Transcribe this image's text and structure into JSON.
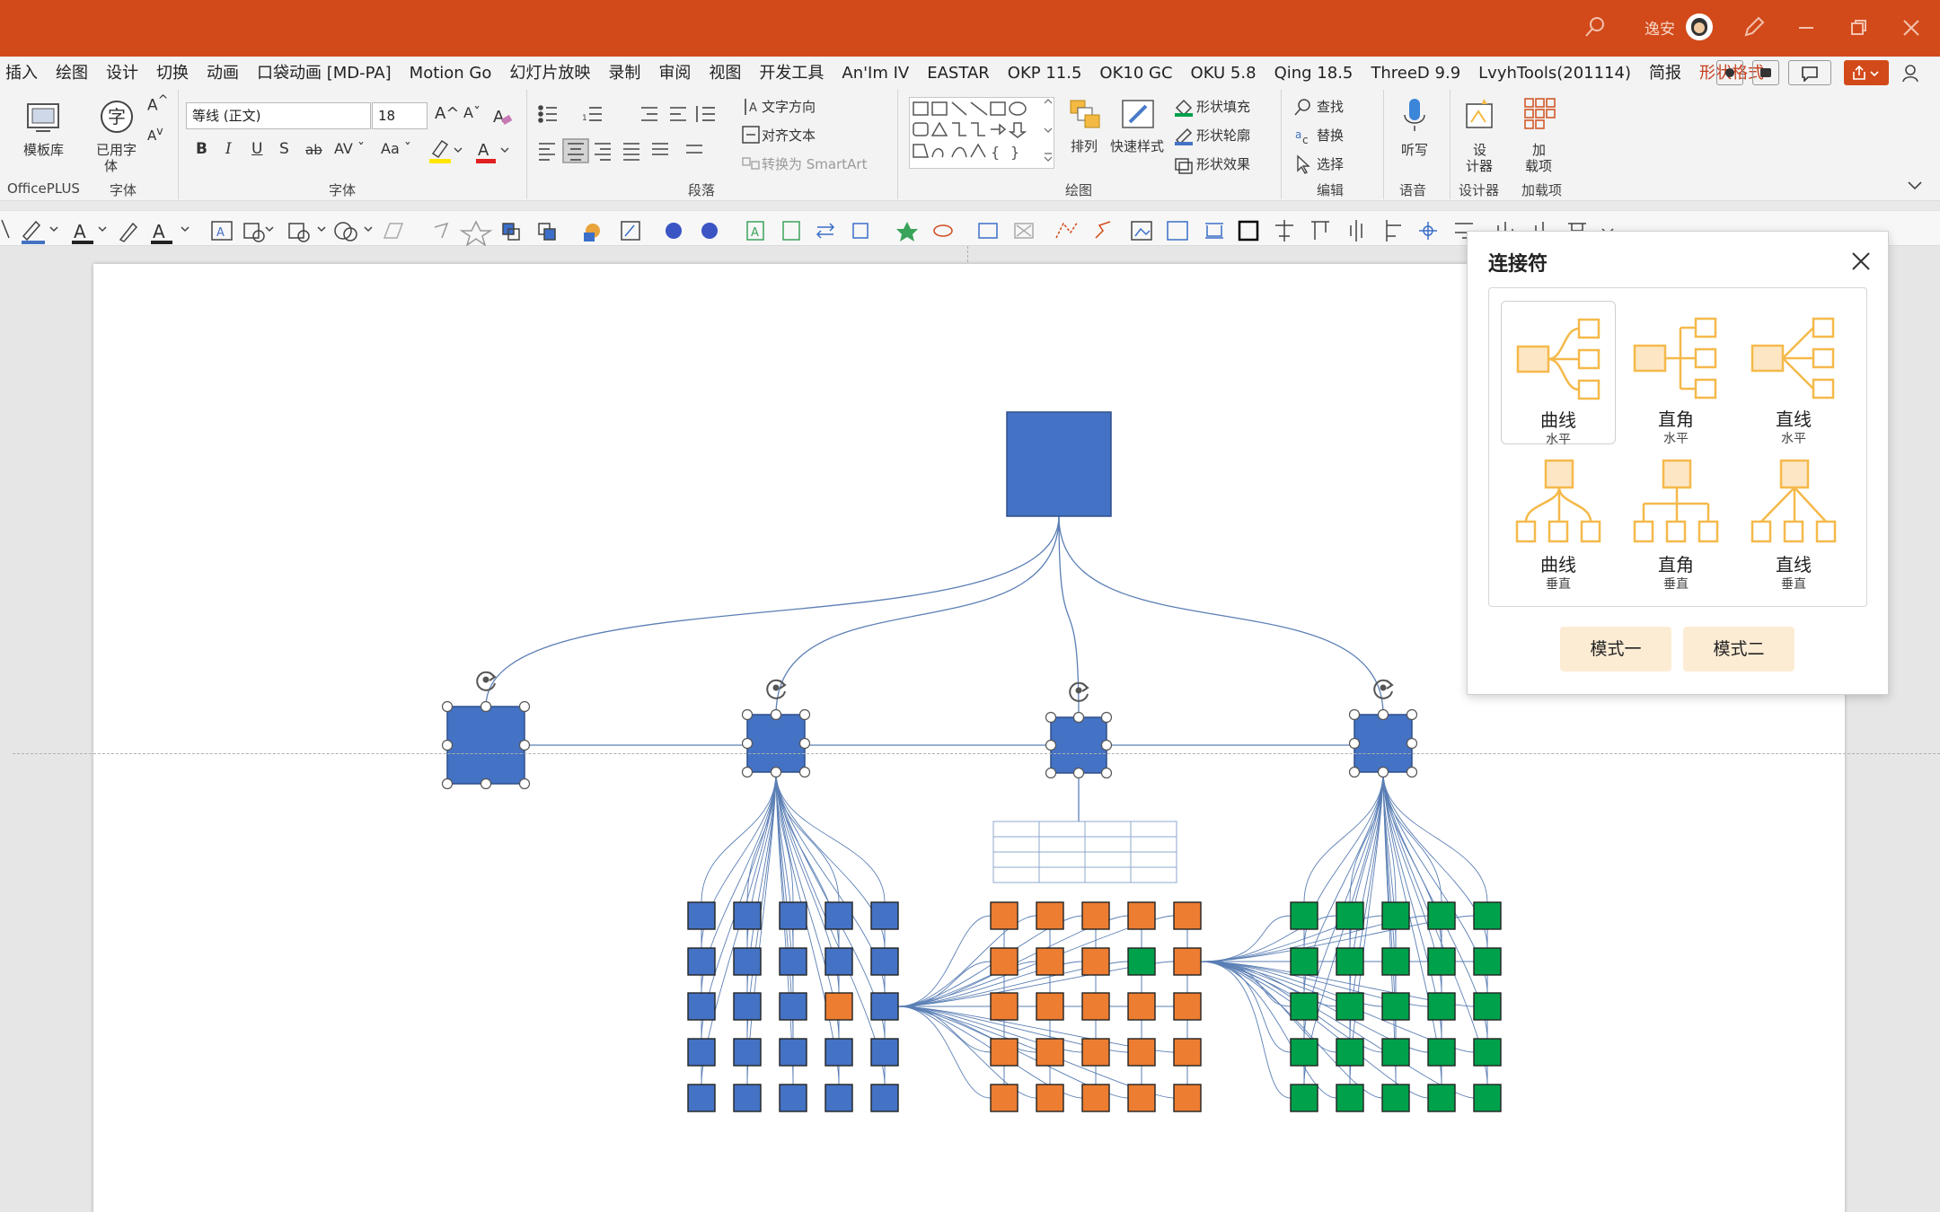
{
  "titlebar": {
    "user_name": "逸安"
  },
  "tabs": [
    {
      "label": "插入"
    },
    {
      "label": "绘图"
    },
    {
      "label": "设计"
    },
    {
      "label": "切换"
    },
    {
      "label": "动画"
    },
    {
      "label": "口袋动画 [MD-PA]"
    },
    {
      "label": "Motion Go"
    },
    {
      "label": "幻灯片放映"
    },
    {
      "label": "录制"
    },
    {
      "label": "审阅"
    },
    {
      "label": "视图"
    },
    {
      "label": "开发工具"
    },
    {
      "label": "An'Im IV"
    },
    {
      "label": "EASTAR"
    },
    {
      "label": "OKP 11.5"
    },
    {
      "label": "OK10 GC"
    },
    {
      "label": "OKU 5.8"
    },
    {
      "label": "Qing 18.5"
    },
    {
      "label": "ThreeD 9.9"
    },
    {
      "label": "LvyhTools(201114)"
    },
    {
      "label": "简报"
    },
    {
      "label": "形状格式"
    }
  ],
  "ribbon": {
    "template_library": "模板库",
    "used_font_1": "已用字",
    "used_font_2": "体",
    "font_name": "等线 (正文)",
    "font_size": "18",
    "text_direction": "文字方向",
    "align_text": "对齐文本",
    "convert_smartart": "转换为 SmartArt",
    "arrange": "排列",
    "quick_styles": "快速样式",
    "shape_fill": "形状填充",
    "shape_outline": "形状轮廓",
    "shape_effects": "形状效果",
    "find": "查找",
    "replace": "替换",
    "select": "选择",
    "dictate": "听写",
    "designer_1": "设",
    "designer_2": "计器",
    "addins_1": "加",
    "addins_2": "载项",
    "bold": "B",
    "italic": "I",
    "underline": "U",
    "shadow": "S",
    "strike": "ab",
    "groups": {
      "officeplus": "OfficePLUS",
      "font1": "字体",
      "font2": "字体",
      "paragraph": "段落",
      "drawing": "绘图",
      "editing": "编辑",
      "voice": "语音",
      "designer": "设计器",
      "addins": "加载项"
    }
  },
  "panel": {
    "title": "连接符",
    "options": [
      {
        "label": "曲线",
        "sub": "水平"
      },
      {
        "label": "直角",
        "sub": "水平"
      },
      {
        "label": "直线",
        "sub": "水平"
      },
      {
        "label": "曲线",
        "sub": "垂直"
      },
      {
        "label": "直角",
        "sub": "垂直"
      },
      {
        "label": "直线",
        "sub": "垂直"
      }
    ],
    "mode1": "模式一",
    "mode2": "模式二"
  },
  "colors": {
    "accent": "#d24a1a",
    "blue": "#4472c4",
    "orange": "#ed7d31",
    "green": "#00a14b",
    "line": "#5b7fb5",
    "connector_icon": "#f5b94a"
  }
}
